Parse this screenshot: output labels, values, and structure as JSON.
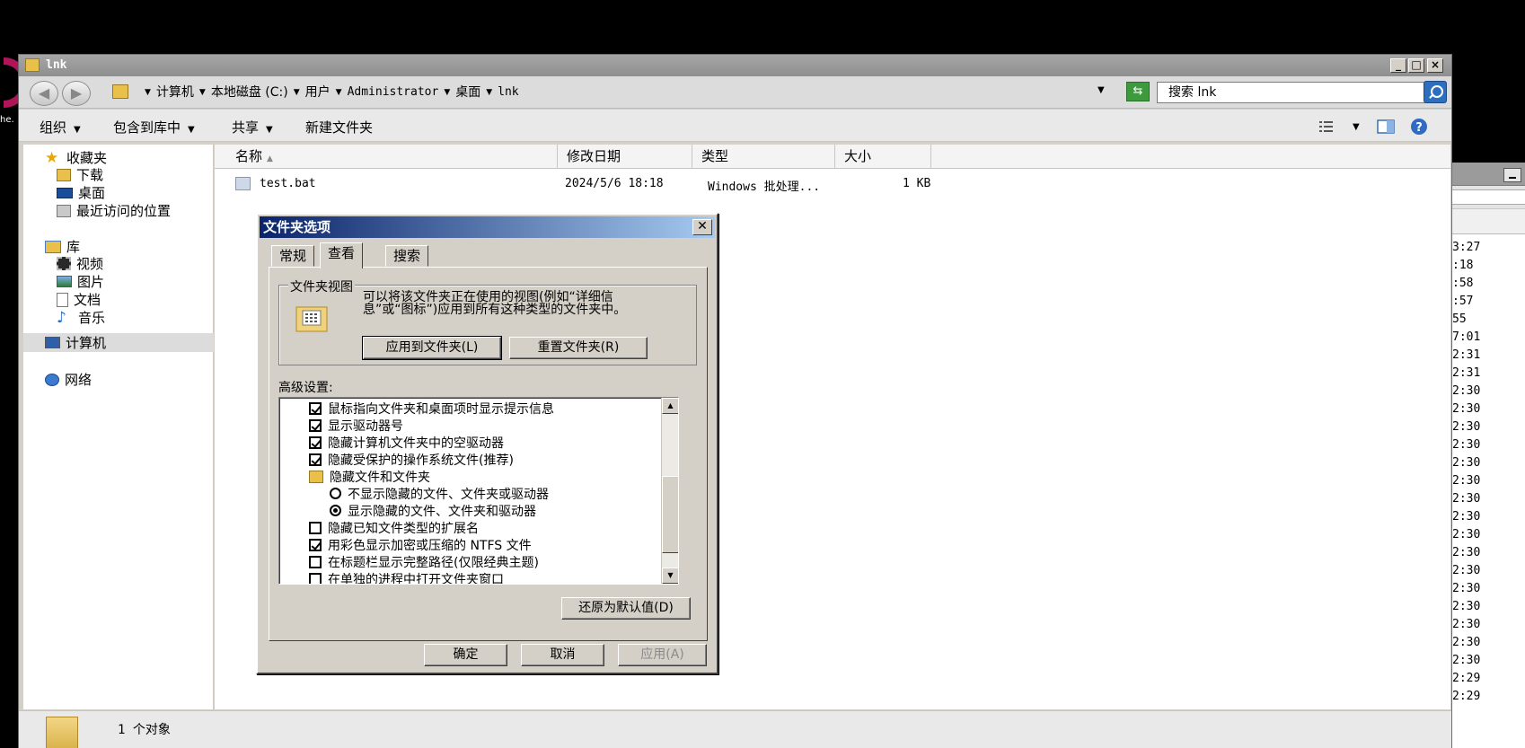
{
  "background": {
    "logo_text": "he.",
    "times": [
      ":27",
      ":18",
      ":58",
      ":57",
      "55",
      ":01",
      ":31",
      ":31",
      ":30",
      ":30",
      ":30",
      ":30",
      ":30",
      ":30",
      ":30",
      ":30",
      ":30",
      ":30",
      ":30",
      ":30",
      ":30",
      ":30",
      ":30",
      ":30",
      ":29",
      ":29"
    ],
    "time_prefixes": [
      "3",
      "",
      "",
      "",
      "",
      "7",
      "2",
      "2",
      "2",
      "2",
      "2",
      "2",
      "2",
      "2",
      "2",
      "2",
      "2",
      "2",
      "2",
      "2",
      "2",
      "2",
      "2",
      "2",
      "2",
      "2"
    ]
  },
  "window": {
    "title": "lnk",
    "min_glyph": "_",
    "max_glyph": "□",
    "close_glyph": "×"
  },
  "address": {
    "crumbs": [
      "计算机",
      "本地磁盘 (C:)",
      "用户",
      "Administrator",
      "桌面",
      "lnk"
    ],
    "search_placeholder": "搜索 lnk",
    "back_glyph": "◀",
    "forward_glyph": "▶"
  },
  "toolbar": {
    "organize": "组织",
    "include_library": "包含到库中",
    "share": "共享",
    "new_folder": "新建文件夹"
  },
  "nav": {
    "favorites": "收藏夹",
    "downloads": "下载",
    "desktop": "桌面",
    "recent": "最近访问的位置",
    "libraries": "库",
    "videos": "视频",
    "pictures": "图片",
    "documents": "文档",
    "music": "音乐",
    "computer": "计算机",
    "network": "网络"
  },
  "columns": {
    "name": "名称",
    "modified": "修改日期",
    "type": "类型",
    "size": "大小"
  },
  "files": [
    {
      "name": "test.bat",
      "modified": "2024/5/6 18:18",
      "type": "Windows 批处理...",
      "size": "1 KB"
    }
  ],
  "status": {
    "count": "1 个对象"
  },
  "dialog": {
    "title": "文件夹选项",
    "close": "✕",
    "tabs": [
      "常规",
      "查看",
      "搜索"
    ],
    "folder_views_label": "文件夹视图",
    "folder_views_desc": "可以将该文件夹正在使用的视图(例如“详细信息”或“图标”)应用到所有这种类型的文件夹中。",
    "apply_to_folders": "应用到文件夹(L)",
    "reset_folders": "重置文件夹(R)",
    "advanced_label": "高级设置:",
    "advanced_items": [
      {
        "kind": "check",
        "checked": true,
        "label": "鼠标指向文件夹和桌面项时显示提示信息"
      },
      {
        "kind": "check",
        "checked": true,
        "label": "显示驱动器号"
      },
      {
        "kind": "check",
        "checked": true,
        "label": "隐藏计算机文件夹中的空驱动器"
      },
      {
        "kind": "check",
        "checked": true,
        "label": "隐藏受保护的操作系统文件(推荐)"
      },
      {
        "kind": "folder",
        "label": "隐藏文件和文件夹"
      },
      {
        "kind": "radio",
        "checked": false,
        "label": "不显示隐藏的文件、文件夹或驱动器"
      },
      {
        "kind": "radio",
        "checked": true,
        "label": "显示隐藏的文件、文件夹和驱动器"
      },
      {
        "kind": "check",
        "checked": false,
        "label": "隐藏已知文件类型的扩展名"
      },
      {
        "kind": "check",
        "checked": true,
        "label": "用彩色显示加密或压缩的 NTFS 文件"
      },
      {
        "kind": "check",
        "checked": false,
        "label": "在标题栏显示完整路径(仅限经典主题)"
      },
      {
        "kind": "check",
        "checked": false,
        "label": "在单独的进程中打开文件夹窗口"
      }
    ],
    "restore_defaults": "还原为默认值(D)",
    "ok": "确定",
    "cancel": "取消",
    "apply": "应用(A)"
  }
}
